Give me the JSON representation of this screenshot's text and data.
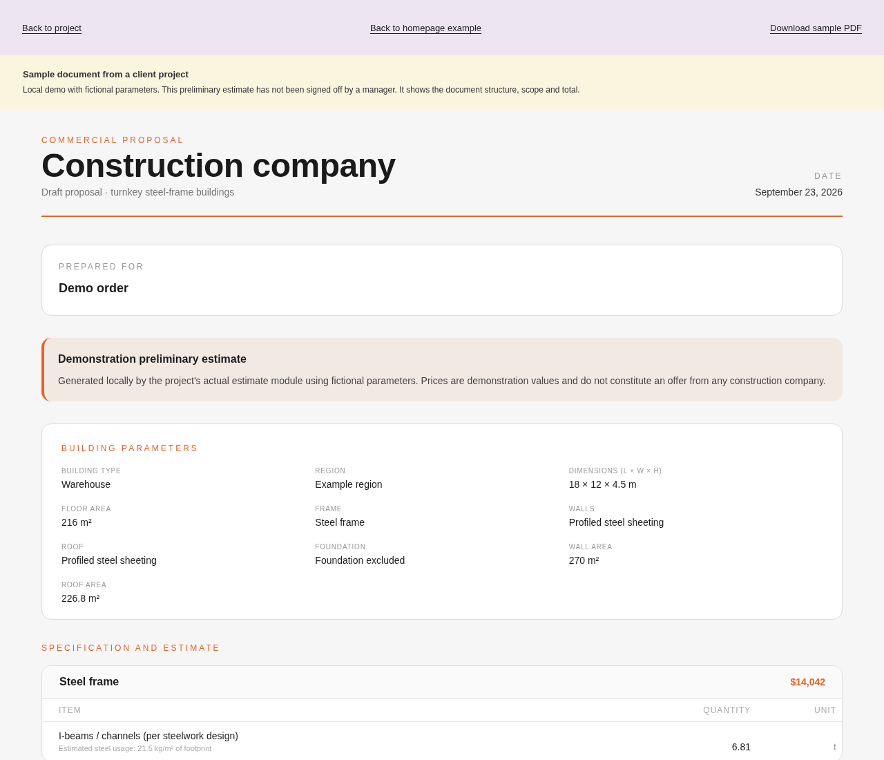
{
  "top_nav": {
    "links": [
      "Back to project",
      "Back to homepage example",
      "Download sample PDF"
    ]
  },
  "notice": {
    "title": "Sample document from a client project",
    "text": "Local demo with fictional parameters. This preliminary estimate has not been signed off by a manager. It shows the document structure, scope and total."
  },
  "header": {
    "eyebrow": "COMMERCIAL PROPOSAL",
    "title": "Construction company",
    "subtitle": "Draft proposal · turnkey steel-frame buildings",
    "date_label": "DATE",
    "date": "September 23, 2026"
  },
  "prepared_for": {
    "label": "PREPARED FOR",
    "value": "Demo order"
  },
  "callout": {
    "title": "Demonstration preliminary estimate",
    "text": "Generated locally by the project's actual estimate module using fictional parameters. Prices are demonstration values and do not constitute an offer from any construction company."
  },
  "parameters": {
    "title": "BUILDING PARAMETERS",
    "items": [
      {
        "label": "BUILDING TYPE",
        "value": "Warehouse"
      },
      {
        "label": "REGION",
        "value": "Example region"
      },
      {
        "label": "DIMENSIONS (L × W × H)",
        "value": "18 × 12 × 4.5 m"
      },
      {
        "label": "FLOOR AREA",
        "value": "216 m²"
      },
      {
        "label": "FRAME",
        "value": "Steel frame"
      },
      {
        "label": "WALLS",
        "value": "Profiled steel sheeting"
      },
      {
        "label": "ROOF",
        "value": "Profiled steel sheeting"
      },
      {
        "label": "FOUNDATION",
        "value": "Foundation excluded"
      },
      {
        "label": "WALL AREA",
        "value": "270 m²"
      },
      {
        "label": "ROOF AREA",
        "value": "226.8 m²"
      }
    ]
  },
  "specification": {
    "title": "SPECIFICATION AND ESTIMATE",
    "sections": [
      {
        "name": "Steel frame",
        "total": "$14,042",
        "columns": [
          "ITEM",
          "QUANTITY",
          "UNIT"
        ],
        "rows": [
          {
            "item": "I-beams / channels (per steelwork design)",
            "note": "Estimated steel usage: 21.5 kg/m² of footprint",
            "quantity": "6.81",
            "unit": "t"
          }
        ]
      }
    ]
  }
}
